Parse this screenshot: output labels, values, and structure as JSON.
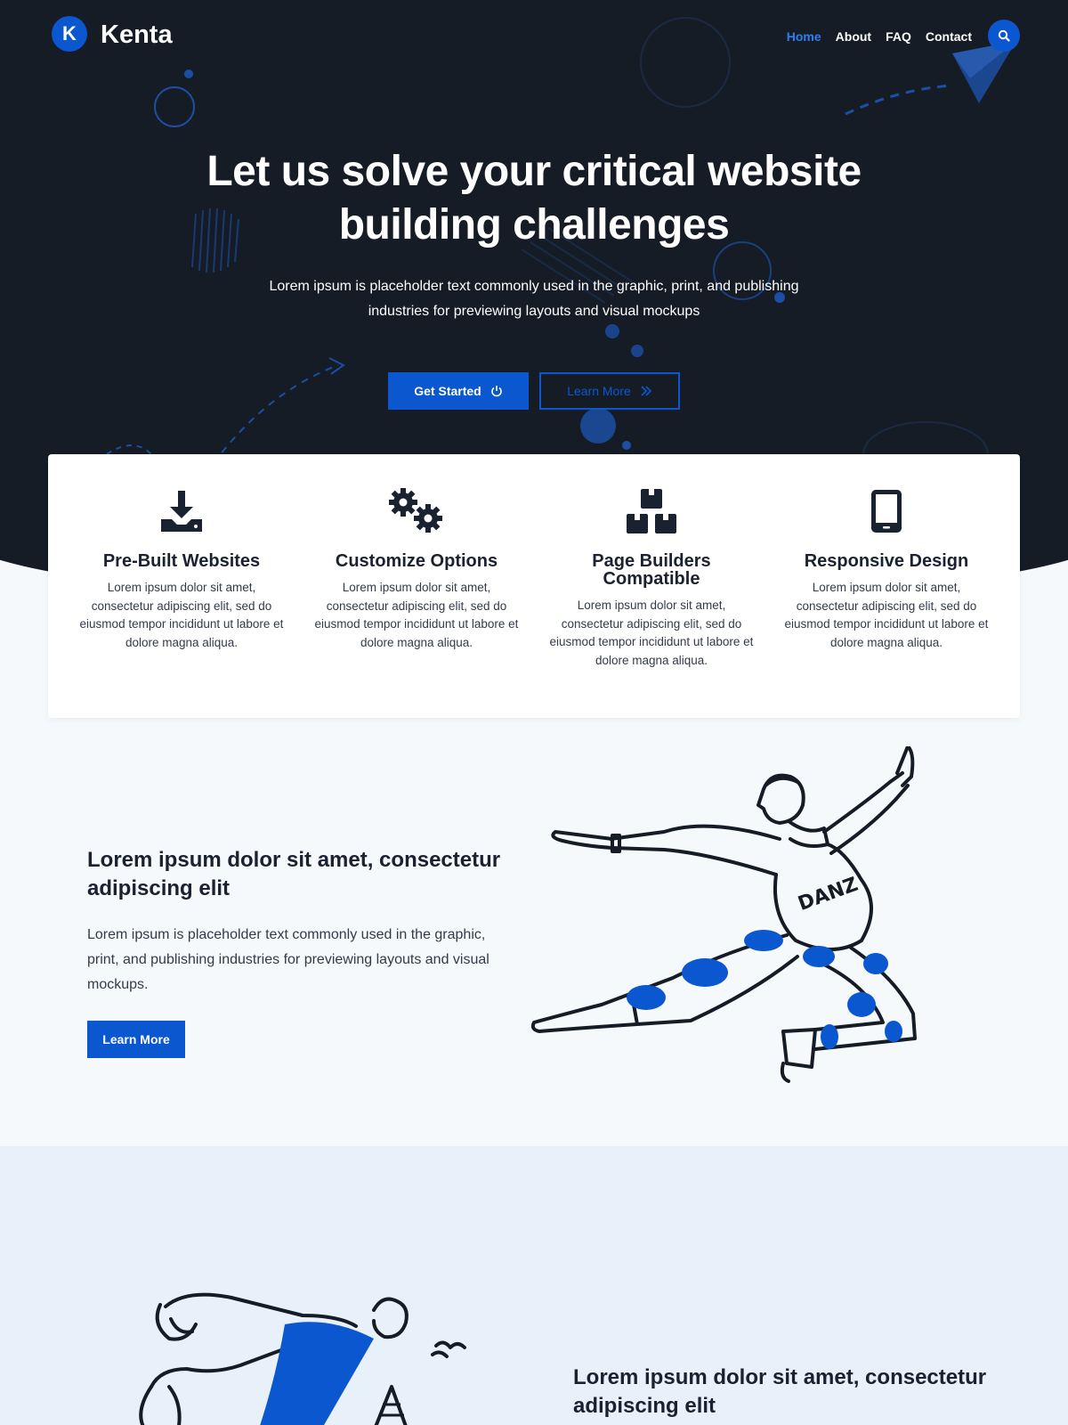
{
  "brand": {
    "logo_letter": "K",
    "name": "Kenta"
  },
  "nav": {
    "items": [
      {
        "label": "Home",
        "active": true
      },
      {
        "label": "About",
        "active": false
      },
      {
        "label": "FAQ",
        "active": false
      },
      {
        "label": "Contact",
        "active": false
      }
    ],
    "search_icon": "search-icon"
  },
  "hero": {
    "title": "Let us solve your critical website building challenges",
    "subtitle": "Lorem ipsum is placeholder text commonly used in the graphic, print, and publishing industries for previewing layouts and visual mockups",
    "primary_button": "Get Started",
    "secondary_button": "Learn More"
  },
  "features": [
    {
      "icon": "download-icon",
      "title": "Pre-Built Websites",
      "desc": "Lorem ipsum dolor sit amet, consectetur adipiscing elit, sed do eiusmod tempor incididunt ut labore et dolore magna aliqua."
    },
    {
      "icon": "gears-icon",
      "title": "Customize Options",
      "desc": "Lorem ipsum dolor sit amet, consectetur adipiscing elit, sed do eiusmod tempor incididunt ut labore et dolore magna aliqua."
    },
    {
      "icon": "boxes-icon",
      "title": "Page Builders Compatible",
      "desc": "Lorem ipsum dolor sit amet, consectetur adipiscing elit, sed do eiusmod tempor incididunt ut labore et dolore magna aliqua."
    },
    {
      "icon": "tablet-icon",
      "title": "Responsive Design",
      "desc": "Lorem ipsum dolor sit amet, consectetur adipiscing elit, sed do eiusmod tempor incididunt ut labore et dolore magna aliqua."
    }
  ],
  "section2": {
    "title": "Lorem ipsum dolor sit amet, consectetur adipiscing elit",
    "text": "Lorem ipsum is placeholder text commonly used in the graphic, print, and publishing industries for previewing layouts and visual mockups.",
    "button": "Learn More",
    "shirt_text": "DANZ"
  },
  "section3": {
    "title": "Lorem ipsum dolor sit amet, consectetur adipiscing elit"
  },
  "colors": {
    "accent": "#0b57d0",
    "hero_bg": "#161c26",
    "page_bg": "#f6f9fc",
    "section_bg": "#e8f0f9"
  }
}
